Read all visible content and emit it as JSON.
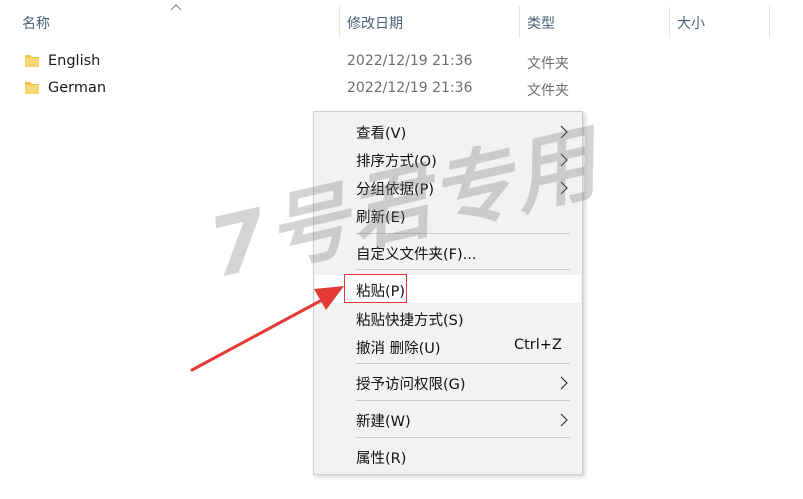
{
  "columns": {
    "name": "名称",
    "modified": "修改日期",
    "type": "类型",
    "size": "大小"
  },
  "files": [
    {
      "name": "English",
      "modified": "2022/12/19 21:36",
      "type": "文件夹"
    },
    {
      "name": "German",
      "modified": "2022/12/19 21:36",
      "type": "文件夹"
    }
  ],
  "context_menu": {
    "view": "查看(V)",
    "sort_by": "排序方式(O)",
    "group_by": "分组依据(P)",
    "refresh": "刷新(E)",
    "customize_folder": "自定义文件夹(F)...",
    "paste": "粘贴(P)",
    "paste_shortcut": "粘贴快捷方式(S)",
    "undo_delete": "撤消 删除(U)",
    "undo_delete_shortcut": "Ctrl+Z",
    "grant_access": "授予访问权限(G)",
    "new": "新建(W)",
    "properties": "属性(R)"
  },
  "watermark": "7号君专用",
  "colors": {
    "folder": "#f4c342",
    "highlight_box": "#e53935",
    "arrow": "#e53935"
  }
}
